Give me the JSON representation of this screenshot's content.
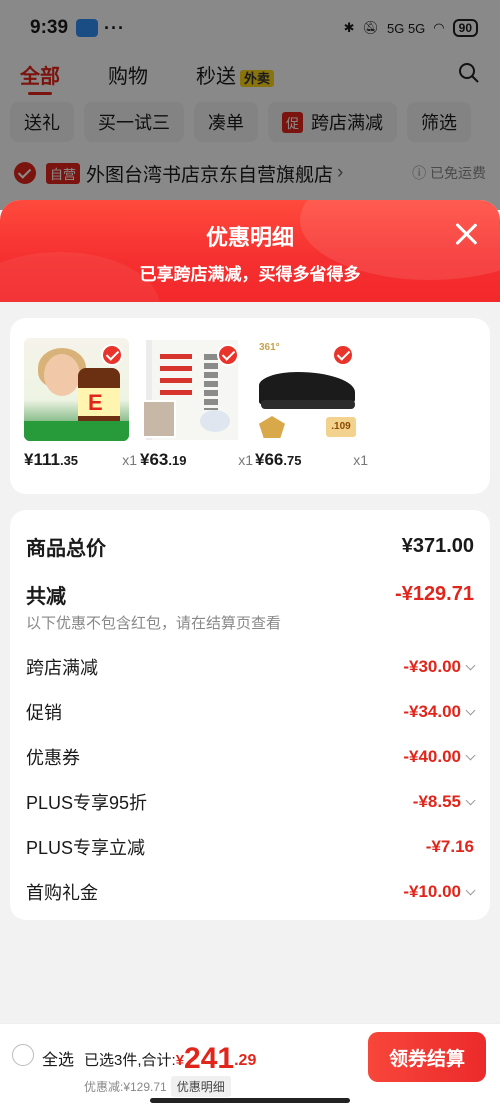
{
  "status_bar": {
    "time": "9:39",
    "dots": "···",
    "signal": "5G 5G",
    "battery": "90"
  },
  "tabs": [
    {
      "label": "全部"
    },
    {
      "label": "购物"
    },
    {
      "label": "秒送",
      "badge": "外卖"
    }
  ],
  "chips": [
    "送礼",
    "买一试三",
    "凑单",
    "跨店满减",
    "筛选"
  ],
  "chip_badge": "促",
  "store": {
    "tag": "自营",
    "name": "外图台湾书店京东自营旗舰店",
    "arrow": "›",
    "shipping": "ⓘ 已免运费"
  },
  "sheet": {
    "title": "优惠明细",
    "subtitle": "已享跨店满减，买得多省得多",
    "products": [
      {
        "price_int": "¥111",
        "price_dec": ".35",
        "qty": "x1"
      },
      {
        "price_int": "¥63",
        "price_dec": ".19",
        "qty": "x1"
      },
      {
        "price_int": "¥66",
        "price_dec": ".75",
        "qty": "x1"
      }
    ],
    "shoe_logo": "361°",
    "shoe_tag": ".109",
    "summary": {
      "total_label": "商品总价",
      "total_value": "¥371.00",
      "discount_label": "共减",
      "discount_value": "-¥129.71",
      "note": "以下优惠不包含红包，请在结算页查看",
      "items": [
        {
          "label": "跨店满减",
          "value": "-¥30.00"
        },
        {
          "label": "促销",
          "value": "-¥34.00"
        },
        {
          "label": "优惠券",
          "value": "-¥40.00"
        },
        {
          "label": "PLUS专享95折",
          "value": "-¥8.55"
        },
        {
          "label": "PLUS专享立减",
          "value": "-¥7.16"
        },
        {
          "label": "首购礼金",
          "value": "-¥10.00"
        }
      ]
    }
  },
  "footer": {
    "select_all": "全选",
    "selected_text": "已选3件,合计:",
    "total_symbol": "¥",
    "total_int": "241",
    "total_dec": ".29",
    "discount_text": "优惠减:¥129.71",
    "detail_chip": "优惠明细",
    "checkout": "领券结算"
  },
  "colors": {
    "accent": "#e1251b",
    "header_red": "#f52f2f"
  }
}
